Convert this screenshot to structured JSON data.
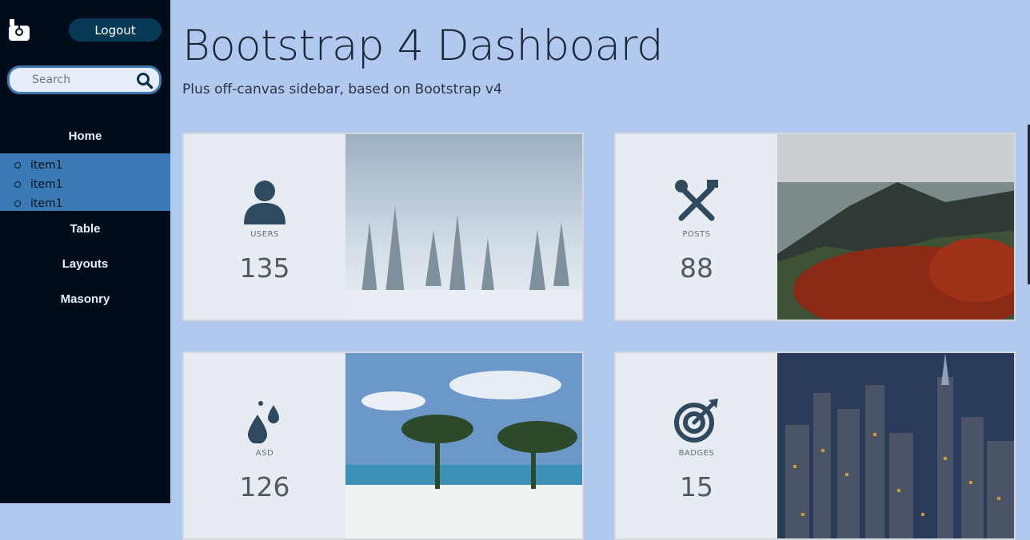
{
  "sidebar": {
    "logout_label": "Logout",
    "search_placeholder": "Search",
    "nav": {
      "home": "Home",
      "submenu": [
        "item1",
        "item1",
        "item1"
      ],
      "table": "Table",
      "layouts": "Layouts",
      "masonry": "Masonry"
    }
  },
  "header": {
    "title": "Bootstrap 4 Dashboard",
    "subtitle": "Plus off-canvas sidebar, based on Bootstrap v4"
  },
  "cards": [
    {
      "label": "USERS",
      "value": "135",
      "icon": "user-icon"
    },
    {
      "label": "POSTS",
      "value": "88",
      "icon": "tools-icon"
    },
    {
      "label": "ASD",
      "value": "126",
      "icon": "drops-icon"
    },
    {
      "label": "BADGES",
      "value": "15",
      "icon": "target-icon"
    }
  ],
  "colors": {
    "sidebar_bg": "#010c1a",
    "main_bg": "#b1c8ef",
    "submenu_bg": "#3a7ab4",
    "logout_bg": "#083a55",
    "icon_color": "#2f4a5e"
  }
}
